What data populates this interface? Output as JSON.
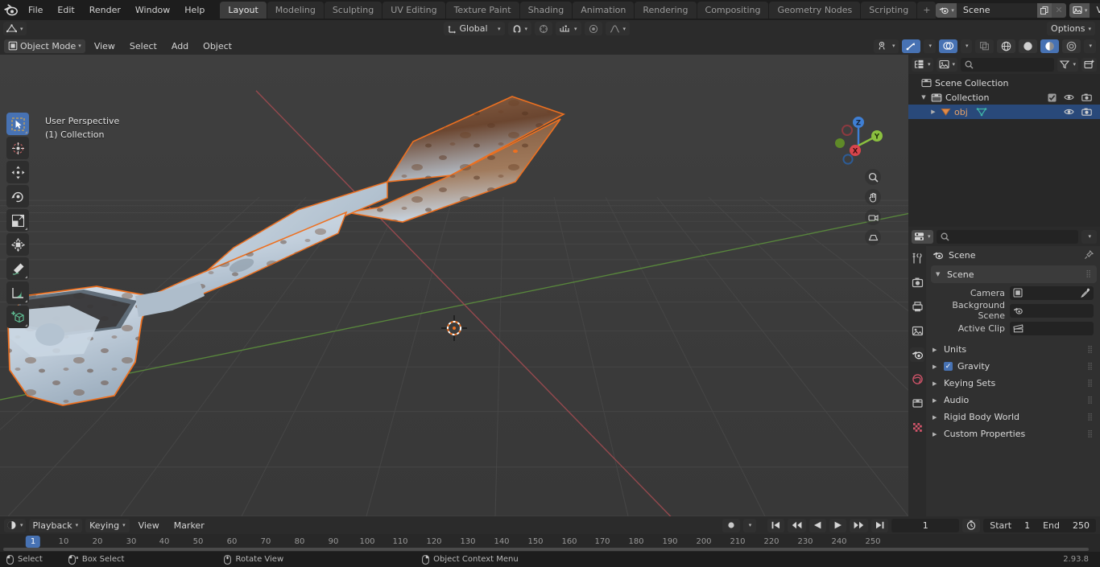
{
  "app": {
    "name": "Blender",
    "version": "2.93.8"
  },
  "topbar": {
    "logo_icon": "blender-logo-icon",
    "menus": [
      "File",
      "Edit",
      "Render",
      "Window",
      "Help"
    ],
    "workspaces": [
      {
        "label": "Layout",
        "active": true
      },
      {
        "label": "Modeling",
        "active": false
      },
      {
        "label": "Sculpting",
        "active": false
      },
      {
        "label": "UV Editing",
        "active": false
      },
      {
        "label": "Texture Paint",
        "active": false
      },
      {
        "label": "Shading",
        "active": false
      },
      {
        "label": "Animation",
        "active": false
      },
      {
        "label": "Rendering",
        "active": false
      },
      {
        "label": "Compositing",
        "active": false
      },
      {
        "label": "Geometry Nodes",
        "active": false
      },
      {
        "label": "Scripting",
        "active": false
      }
    ],
    "add_workspace_label": "+",
    "scene": {
      "icon": "scene-icon",
      "value": "Scene",
      "copy_icon": "duplicate-icon",
      "unlink_icon": "x-icon"
    },
    "view_layer": {
      "icon": "view-layer-icon",
      "value": "View Layer",
      "copy_icon": "duplicate-icon",
      "unlink_icon": "x-icon"
    }
  },
  "viewport_header": {
    "editor_type_icon": "editor-type-icon",
    "mode": {
      "icon": "object-mode-icon",
      "label": "Object Mode"
    },
    "menus": [
      "View",
      "Select",
      "Add",
      "Object"
    ],
    "transform_orientation": {
      "icon": "orientation-icon",
      "label": "Global"
    },
    "snap": {
      "icon": "magnet-icon",
      "enabled": false
    },
    "proportional": {
      "icon": "proportional-icon",
      "enabled": false
    },
    "proportional_falloff": {
      "icon": "falloff-curve-icon"
    },
    "snap_target_icon": "snap-increment-icon",
    "options_label": "Options",
    "visibility_icon": "visibility-icon",
    "gizmo_icon": "gizmo-icon",
    "overlays_icon": "overlays-icon",
    "xray_icon": "xray-icon",
    "shading_modes": [
      {
        "icon": "wireframe-icon",
        "active": false
      },
      {
        "icon": "solid-icon",
        "active": false
      },
      {
        "icon": "material-preview-icon",
        "active": true
      },
      {
        "icon": "rendered-icon",
        "active": false
      }
    ]
  },
  "viewport": {
    "perspective_label": "User Perspective",
    "collection_label": "(1) Collection",
    "background_color": "#3b3b3b",
    "grid_color": "#4a4a4a",
    "x_axis_color": "#9b4a4f",
    "y_axis_color": "#5a8a3c",
    "selection_outline_color": "#ed7020",
    "object_base_color": "#c2d0dc",
    "object_rust_color": "#7a4a32",
    "gizmo": {
      "axes": [
        {
          "label": "Z",
          "color": "#3f7fd4"
        },
        {
          "label": "Y",
          "color": "#8bc03f"
        },
        {
          "label": "X",
          "color": "#d9454c"
        }
      ]
    },
    "toolbar": [
      {
        "icon": "tweak-select-box-icon",
        "active": true
      },
      {
        "icon": "cursor-icon",
        "active": false
      },
      {
        "icon": "move-icon",
        "active": false
      },
      {
        "icon": "rotate-icon",
        "active": false
      },
      {
        "icon": "scale-icon",
        "active": false
      },
      {
        "icon": "transform-icon",
        "active": false
      },
      {
        "icon": "annotate-icon",
        "active": false
      },
      {
        "icon": "measure-icon",
        "active": false
      },
      {
        "icon": "add-cube-icon",
        "active": false
      }
    ],
    "nav_buttons": [
      {
        "icon": "zoom-icon"
      },
      {
        "icon": "hand-pan-icon"
      },
      {
        "icon": "camera-view-icon"
      },
      {
        "icon": "ortho-persp-icon"
      }
    ]
  },
  "outliner": {
    "display_mode_icon": "outliner-display-icon",
    "filter_id_icon": "id-type-icon",
    "search_icon": "search-icon",
    "search_value": "",
    "filter_icon": "funnel-icon",
    "new_collection_icon": "new-collection-icon",
    "rows": [
      {
        "name": "Scene Collection",
        "icon": "scene-collection-icon",
        "indent": 0,
        "selected": false,
        "expand": "",
        "show_checkbox": false,
        "show_eye": false,
        "show_camera": false
      },
      {
        "name": "Collection",
        "icon": "collection-icon",
        "indent": 1,
        "selected": false,
        "expand": "▼",
        "show_checkbox": true,
        "show_eye": true,
        "show_camera": true
      },
      {
        "name": "obj",
        "icon": "mesh-object-icon",
        "data_icon": "mesh-data-icon",
        "indent": 2,
        "selected": true,
        "expand": "▶",
        "show_checkbox": false,
        "show_eye": true,
        "show_camera": true
      }
    ]
  },
  "properties": {
    "editor_icon": "properties-editor-icon",
    "search_icon": "search-icon",
    "search_value": "",
    "options_caret": "chevron-down-icon",
    "tabs": [
      {
        "icon": "tool-icon",
        "name": "tool",
        "active": false
      },
      {
        "icon": "render-icon",
        "name": "render",
        "active": false
      },
      {
        "icon": "output-icon",
        "name": "output",
        "active": false
      },
      {
        "icon": "view-layer-icon",
        "name": "view-layer",
        "active": false
      },
      {
        "icon": "scene-icon",
        "name": "scene",
        "active": true
      },
      {
        "icon": "world-icon",
        "name": "world",
        "active": false
      },
      {
        "icon": "object-icon",
        "name": "object",
        "active": false
      },
      {
        "icon": "texture-icon",
        "name": "texture",
        "active": false
      }
    ],
    "breadcrumb": {
      "icon": "scene-icon",
      "label": "Scene",
      "pin_icon": "pin-icon"
    },
    "panel_title": "Scene",
    "fields": [
      {
        "label": "Camera",
        "icon": "camera-field-icon",
        "value": "",
        "eyedropper": true
      },
      {
        "label": "Background Scene",
        "icon": "scene-field-icon",
        "value": "",
        "eyedropper": false
      },
      {
        "label": "Active Clip",
        "icon": "clip-field-icon",
        "value": "",
        "eyedropper": false
      }
    ],
    "accordions": [
      {
        "label": "Units",
        "checkbox": false
      },
      {
        "label": "Gravity",
        "checkbox": true,
        "checked": true
      },
      {
        "label": "Keying Sets",
        "checkbox": false
      },
      {
        "label": "Audio",
        "checkbox": false
      },
      {
        "label": "Rigid Body World",
        "checkbox": false
      },
      {
        "label": "Custom Properties",
        "checkbox": false
      }
    ]
  },
  "timeline": {
    "editor_icon": "timeline-editor-icon",
    "playback_label": "Playback",
    "keying_label": "Keying",
    "view_label": "View",
    "marker_label": "Marker",
    "record_icon": "record-icon",
    "transport": [
      {
        "icon": "jump-start-icon"
      },
      {
        "icon": "prev-keyframe-icon"
      },
      {
        "icon": "play-reverse-icon"
      },
      {
        "icon": "play-icon"
      },
      {
        "icon": "next-keyframe-icon"
      },
      {
        "icon": "jump-end-icon"
      }
    ],
    "current_frame": "1",
    "auto_key_icon": "auto-key-icon",
    "start_label": "Start",
    "start_value": "1",
    "end_label": "End",
    "end_value": "250",
    "ruler_ticks": [
      "10",
      "20",
      "30",
      "40",
      "50",
      "60",
      "70",
      "80",
      "90",
      "100",
      "110",
      "120",
      "130",
      "140",
      "150",
      "160",
      "170",
      "180",
      "190",
      "200",
      "210",
      "220",
      "230",
      "240",
      "250"
    ],
    "playhead_frame": "1"
  },
  "status_bar": {
    "items": [
      {
        "icon": "mouse-left-icon",
        "label": "Select"
      },
      {
        "icon": "mouse-left-drag-icon",
        "label": "Box Select"
      },
      {
        "icon": "mouse-middle-icon",
        "label": "Rotate View"
      },
      {
        "icon": "mouse-right-icon",
        "label": "Object Context Menu"
      }
    ],
    "version": "2.93.8"
  }
}
